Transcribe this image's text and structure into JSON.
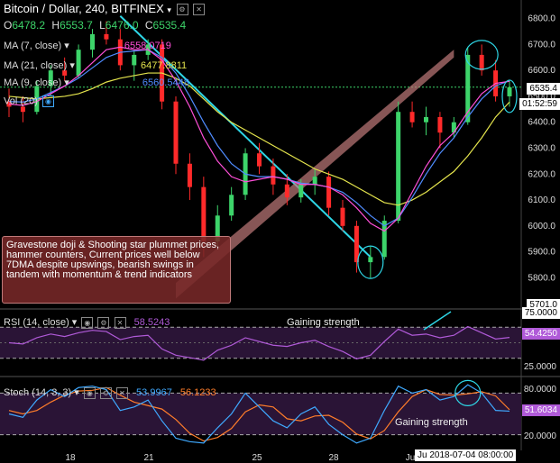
{
  "header": {
    "symbol": "Bitcoin / Dollar, 240, BITFINEX",
    "open_label": "O",
    "open": "6478.2",
    "high_label": "H",
    "high": "6553.7",
    "low_label": "L",
    "low": "6476.0",
    "close_label": "C",
    "close": "6535.4"
  },
  "indicators": {
    "ma7": {
      "label": "MA (7, close)",
      "value": "6558.0719",
      "color": "#ff4fd8"
    },
    "ma21": {
      "label": "MA (21, close)",
      "value": "6477.8811",
      "color": "#e5e54d"
    },
    "ma9": {
      "label": "MA (9, close)",
      "value": "6560.5448",
      "color": "#4f8cff"
    },
    "vol": {
      "label": "Vol (20)"
    },
    "rsi": {
      "label": "RSI (14, close)",
      "value": "58.5243",
      "color": "#b05ad8"
    },
    "stoch": {
      "label": "Stoch (14, 3, 3)",
      "k": "53.9967",
      "d": "56.1233",
      "k_color": "#3fa9ff",
      "d_color": "#ff7d2a"
    }
  },
  "annotation": {
    "text": "Gravestone doji & Shooting star plummet prices, hammer counters, Current prices well below 7DMA despite upswings, bearish swings in tandem with momentum & trend indicators"
  },
  "notes": {
    "rsi_note": "Gaining strength",
    "stoch_note": "Gaining strength"
  },
  "price_tags": {
    "last": "6535.4",
    "countdown": "01:52:59",
    "low_tag": "5701.0"
  },
  "rsi_tags": {
    "rsi_axis_top": "75.0000",
    "rsi_last": "54.4250",
    "rsi_axis_bottom": "25.0000"
  },
  "stoch_tags": {
    "stoch_axis_top": "80.0000",
    "stoch_last": "51.6034",
    "stoch_axis_bottom": "20.0000"
  },
  "crosshair_date": "Ju 2018-07-04 08:00:00",
  "chart_data": {
    "type": "line",
    "price_axis": {
      "ticks": [
        "6800.0",
        "6700.0",
        "6600.0",
        "6500.0",
        "6400.0",
        "6300.0",
        "6200.0",
        "6100.0",
        "6000.0",
        "5900.0",
        "5800.0"
      ],
      "ylim": [
        5690,
        6830
      ]
    },
    "x_axis": {
      "ticks": [
        "18",
        "21",
        "25",
        "28",
        "Ju"
      ]
    },
    "candles_ohlc": [
      [
        6480,
        6530,
        6420,
        6460
      ],
      [
        6460,
        6500,
        6400,
        6440
      ],
      [
        6440,
        6560,
        6430,
        6540
      ],
      [
        6540,
        6620,
        6500,
        6600
      ],
      [
        6600,
        6650,
        6560,
        6580
      ],
      [
        6580,
        6700,
        6570,
        6680
      ],
      [
        6680,
        6760,
        6650,
        6740
      ],
      [
        6740,
        6790,
        6700,
        6720
      ],
      [
        6720,
        6760,
        6600,
        6620
      ],
      [
        6620,
        6680,
        6560,
        6660
      ],
      [
        6660,
        6720,
        6640,
        6700
      ],
      [
        6700,
        6720,
        6450,
        6480
      ],
      [
        6480,
        6500,
        6200,
        6240
      ],
      [
        6240,
        6280,
        6100,
        6150
      ],
      [
        6150,
        6190,
        5880,
        5940
      ],
      [
        5940,
        6080,
        5920,
        6040
      ],
      [
        6040,
        6150,
        6020,
        6120
      ],
      [
        6120,
        6300,
        6100,
        6280
      ],
      [
        6280,
        6320,
        6200,
        6230
      ],
      [
        6230,
        6260,
        6120,
        6160
      ],
      [
        6160,
        6200,
        6080,
        6110
      ],
      [
        6110,
        6180,
        6090,
        6160
      ],
      [
        6160,
        6220,
        6120,
        6190
      ],
      [
        6190,
        6210,
        6040,
        6070
      ],
      [
        6070,
        6100,
        5980,
        6000
      ],
      [
        6000,
        6020,
        5820,
        5860
      ],
      [
        5860,
        5920,
        5800,
        5880
      ],
      [
        5880,
        6040,
        5870,
        6020
      ],
      [
        6020,
        6480,
        6010,
        6440
      ],
      [
        6440,
        6480,
        6380,
        6400
      ],
      [
        6400,
        6460,
        6350,
        6420
      ],
      [
        6420,
        6440,
        6300,
        6360
      ],
      [
        6360,
        6420,
        6340,
        6400
      ],
      [
        6400,
        6690,
        6390,
        6660
      ],
      [
        6660,
        6700,
        6580,
        6600
      ],
      [
        6600,
        6640,
        6480,
        6500
      ],
      [
        6500,
        6560,
        6460,
        6535
      ]
    ],
    "ma7": [
      6470,
      6465,
      6480,
      6510,
      6540,
      6580,
      6630,
      6680,
      6690,
      6680,
      6680,
      6640,
      6560,
      6460,
      6340,
      6250,
      6190,
      6170,
      6180,
      6190,
      6180,
      6160,
      6160,
      6150,
      6120,
      6070,
      6010,
      5980,
      6030,
      6130,
      6230,
      6310,
      6360,
      6440,
      6510,
      6550,
      6558
    ],
    "ma21": [
      6500,
      6495,
      6490,
      6495,
      6500,
      6510,
      6530,
      6555,
      6570,
      6580,
      6590,
      6590,
      6570,
      6540,
      6490,
      6440,
      6400,
      6370,
      6340,
      6310,
      6280,
      6250,
      6220,
      6200,
      6180,
      6150,
      6120,
      6090,
      6080,
      6100,
      6130,
      6170,
      6210,
      6270,
      6340,
      6420,
      6478
    ],
    "ma9": [
      6480,
      6478,
      6490,
      6515,
      6540,
      6570,
      6610,
      6650,
      6670,
      6675,
      6680,
      6650,
      6590,
      6500,
      6400,
      6310,
      6240,
      6200,
      6190,
      6190,
      6180,
      6165,
      6160,
      6150,
      6130,
      6090,
      6040,
      6000,
      6030,
      6110,
      6200,
      6280,
      6340,
      6420,
      6490,
      6540,
      6561
    ],
    "rsi": [
      50,
      48,
      58,
      64,
      60,
      66,
      70,
      68,
      55,
      60,
      62,
      40,
      30,
      26,
      22,
      38,
      46,
      58,
      52,
      46,
      44,
      50,
      54,
      44,
      36,
      24,
      30,
      52,
      72,
      62,
      64,
      58,
      62,
      76,
      66,
      56,
      58.5
    ],
    "stoch_k": [
      50,
      45,
      70,
      85,
      75,
      88,
      90,
      85,
      55,
      60,
      70,
      40,
      15,
      10,
      8,
      30,
      50,
      80,
      60,
      40,
      30,
      50,
      60,
      35,
      20,
      8,
      15,
      55,
      90,
      80,
      85,
      70,
      75,
      92,
      80,
      55,
      54
    ],
    "stoch_d": [
      55,
      50,
      55,
      67,
      77,
      83,
      84,
      88,
      77,
      67,
      62,
      57,
      42,
      22,
      11,
      16,
      29,
      53,
      63,
      60,
      43,
      40,
      47,
      48,
      38,
      21,
      14,
      26,
      53,
      75,
      85,
      78,
      77,
      79,
      82,
      76,
      56
    ]
  }
}
